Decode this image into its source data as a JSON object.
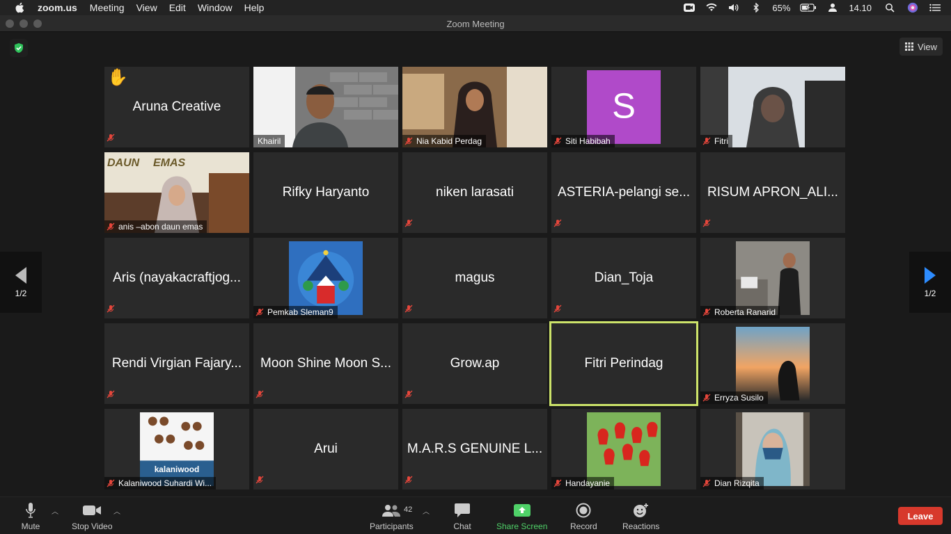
{
  "menubar": {
    "app": "zoom.us",
    "items": [
      "Meeting",
      "View",
      "Edit",
      "Window",
      "Help"
    ],
    "battery": "65%",
    "time": "14.10"
  },
  "window": {
    "title": "Zoom Meeting"
  },
  "top": {
    "view_label": "View"
  },
  "pager": {
    "left": "1/2",
    "right": "1/2"
  },
  "tiles": [
    {
      "name": "Aruna Creative",
      "label": "",
      "muted": true,
      "video": false,
      "hand": true
    },
    {
      "name": "",
      "label": "Khairil",
      "muted": false,
      "video": true
    },
    {
      "name": "",
      "label": "Nia Kabid Perdag",
      "muted": true,
      "video": true
    },
    {
      "name": "",
      "label": "Siti Habibah",
      "muted": true,
      "video": true,
      "avatar_letter": "S"
    },
    {
      "name": "",
      "label": "Fitri",
      "muted": true,
      "video": true
    },
    {
      "name": "",
      "label": "anis –abon daun emas",
      "muted": true,
      "video": true,
      "banner": "DAUN EMAS"
    },
    {
      "name": "Rifky Haryanto",
      "label": "",
      "muted": false,
      "video": false
    },
    {
      "name": "niken larasati",
      "label": "",
      "muted": true,
      "video": false
    },
    {
      "name": "ASTERIA-pelangi se...",
      "label": "",
      "muted": true,
      "video": false
    },
    {
      "name": "RISUM APRON_ALI...",
      "label": "",
      "muted": true,
      "video": false
    },
    {
      "name": "Aris (nayakacraftjog...",
      "label": "",
      "muted": true,
      "video": false
    },
    {
      "name": "",
      "label": "Pemkab Sleman9",
      "muted": true,
      "video": true
    },
    {
      "name": "magus",
      "label": "",
      "muted": true,
      "video": false
    },
    {
      "name": "Dian_Toja",
      "label": "",
      "muted": true,
      "video": false
    },
    {
      "name": "",
      "label": "Roberta Ranarid",
      "muted": true,
      "video": true
    },
    {
      "name": "Rendi Virgian Fajary...",
      "label": "",
      "muted": true,
      "video": false
    },
    {
      "name": "Moon Shine Moon S...",
      "label": "",
      "muted": true,
      "video": false
    },
    {
      "name": "Grow.ap",
      "label": "",
      "muted": true,
      "video": false
    },
    {
      "name": "Fitri Perindag",
      "label": "",
      "muted": false,
      "video": false,
      "active": true
    },
    {
      "name": "",
      "label": "Erryza Susilo",
      "muted": true,
      "video": true
    },
    {
      "name": "",
      "label": "Kalaniwood Suhardi Wi...",
      "muted": true,
      "video": true,
      "brand": "kalaniwood"
    },
    {
      "name": "Arui",
      "label": "",
      "muted": true,
      "video": false
    },
    {
      "name": "M.A.R.S GENUINE L...",
      "label": "",
      "muted": true,
      "video": false
    },
    {
      "name": "",
      "label": "Handayanie",
      "muted": true,
      "video": true
    },
    {
      "name": "",
      "label": "Dian Rizqita",
      "muted": true,
      "video": true
    }
  ],
  "toolbar": {
    "mute": "Mute",
    "stop_video": "Stop Video",
    "participants": "Participants",
    "participants_count": "42",
    "chat": "Chat",
    "share_screen": "Share Screen",
    "record": "Record",
    "reactions": "Reactions",
    "leave": "Leave"
  },
  "colors": {
    "leave": "#d7392c",
    "share": "#4fd168",
    "active_border": "#cde46a",
    "avatar": "#b04ac9"
  }
}
